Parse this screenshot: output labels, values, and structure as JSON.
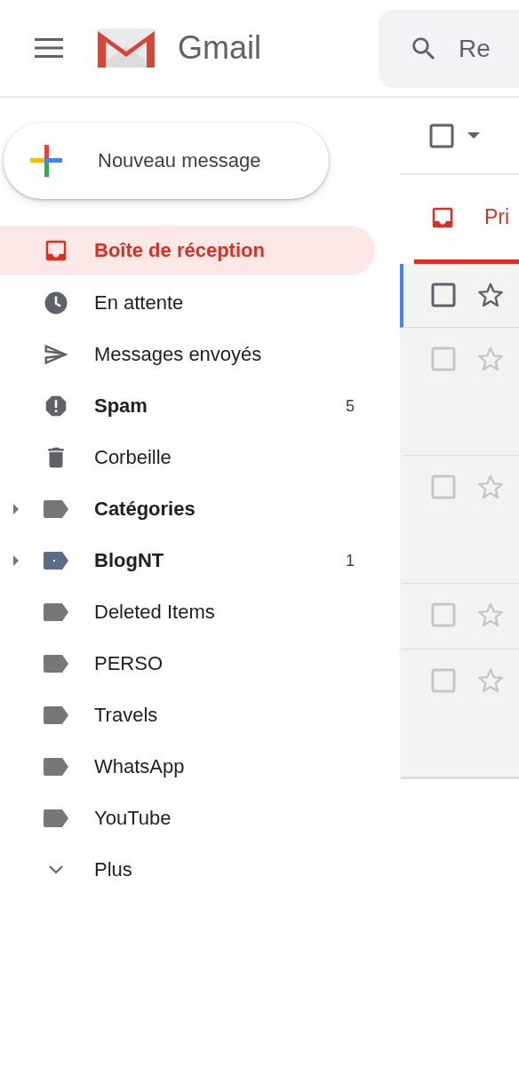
{
  "header": {
    "app_name": "Gmail",
    "search": {
      "placeholder": "Re"
    }
  },
  "compose": {
    "label": "Nouveau message"
  },
  "sidebar": {
    "items": [
      {
        "kind": "inbox",
        "label": "Boîte de réception",
        "selected": true,
        "unread": false
      },
      {
        "kind": "snoozed",
        "label": "En attente",
        "selected": false,
        "unread": false
      },
      {
        "kind": "sent",
        "label": "Messages envoyés",
        "selected": false,
        "unread": false
      },
      {
        "kind": "spam",
        "label": "Spam",
        "selected": false,
        "unread": true,
        "count": "5"
      },
      {
        "kind": "trash",
        "label": "Corbeille",
        "selected": false,
        "unread": false
      },
      {
        "kind": "label",
        "label": "Catégories",
        "selected": false,
        "unread": true,
        "expanded": false,
        "color": "#777777"
      },
      {
        "kind": "label",
        "label": "BlogNT",
        "selected": false,
        "unread": true,
        "expanded": false,
        "color": "#5b6c8b",
        "count": "1"
      },
      {
        "kind": "label",
        "label": "Deleted Items",
        "selected": false,
        "unread": false,
        "color": "#777777"
      },
      {
        "kind": "label",
        "label": "PERSO",
        "selected": false,
        "unread": false,
        "color": "#777777"
      },
      {
        "kind": "label",
        "label": "Travels",
        "selected": false,
        "unread": false,
        "color": "#777777"
      },
      {
        "kind": "label",
        "label": "WhatsApp",
        "selected": false,
        "unread": false,
        "color": "#777777"
      },
      {
        "kind": "label",
        "label": "YouTube",
        "selected": false,
        "unread": false,
        "color": "#777777"
      },
      {
        "kind": "more",
        "label": "Plus",
        "selected": false,
        "unread": false
      }
    ]
  },
  "main": {
    "select_all": {
      "checked": false
    },
    "tabs": [
      {
        "label": "Pri",
        "selected": true
      }
    ],
    "messages": [
      {
        "focused": true,
        "checked": false,
        "starred": false
      },
      {
        "focused": false,
        "checked": false,
        "starred": false
      },
      {
        "focused": false,
        "checked": false,
        "starred": false
      },
      {
        "focused": false,
        "checked": false,
        "starred": false
      },
      {
        "focused": false,
        "checked": false,
        "starred": false
      }
    ]
  }
}
